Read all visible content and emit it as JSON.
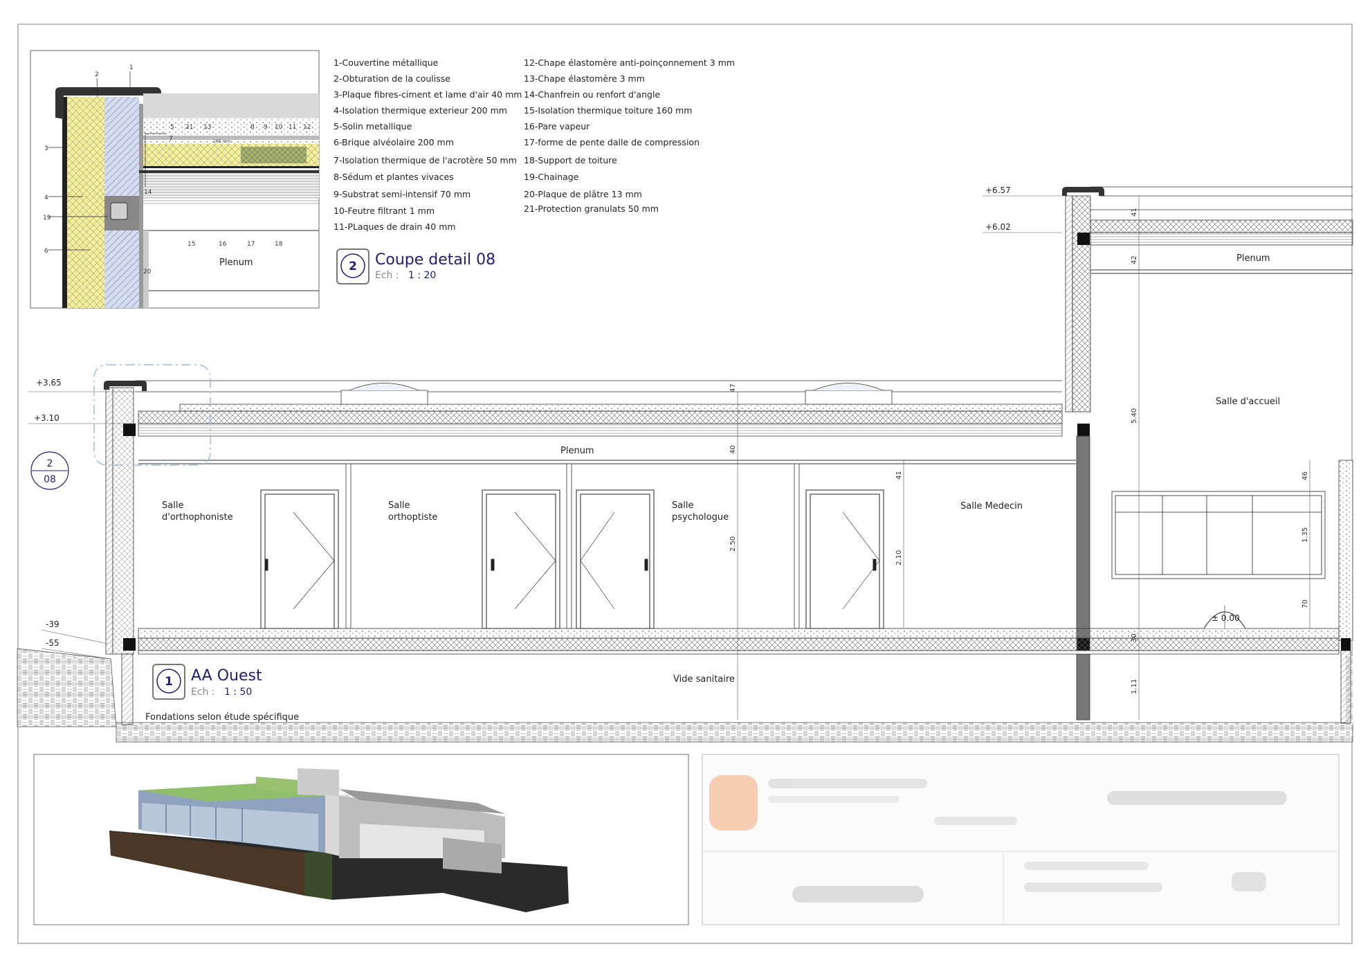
{
  "detail": {
    "callouts": [
      "1",
      "2",
      "3",
      "4",
      "19",
      "6",
      "5",
      "21",
      "13",
      "7",
      "8",
      "9",
      "10",
      "11",
      "12",
      "14",
      "15",
      "16",
      "17",
      "18",
      "20"
    ],
    "dim_small": "160 mm",
    "plenum": "Plenum",
    "bubble_number": "2",
    "title": "Coupe detail 08",
    "scale_prefix": "Ech :",
    "scale_value": "1 : 20"
  },
  "legend": {
    "col1": [
      "1-Couvertine métallique",
      "2-Obturation de la coulisse",
      "3-Plaque fibres-ciment et lame d'air 40 mm",
      "4-Isolation thermique exterieur 200 mm",
      "5-Solin metallique",
      "6-Brique alvéolaire 200 mm",
      "7-Isolation thermique de l'acrotère 50 mm",
      "8-Sédum et plantes vivaces",
      "9-Substrat semi-intensif 70 mm",
      "10-Feutre filtrant 1 mm",
      "11-PLaques de drain 40 mm"
    ],
    "col2": [
      "12-Chape élastomère anti-poinçonnement 3 mm",
      "13-Chape élastomère 3 mm",
      "14-Chanfrein ou renfort d'angle",
      "15-Isolation thermique toiture 160 mm",
      "16-Pare vapeur",
      "17-forme de pente dalle de compression",
      "18-Support de toiture",
      "19-Chainage",
      "20-Plaque de plâtre 13 mm",
      "21-Protection granulats 50 mm"
    ]
  },
  "section": {
    "levels": {
      "l657": "+6.57",
      "l602": "+6.02",
      "l365": "+3.65",
      "l310": "+3.10",
      "m39": "-39",
      "m55": "-55",
      "zero": "± 0.00"
    },
    "detail_ref": {
      "num": "2",
      "sheet": "08"
    },
    "rooms": {
      "plenum_low": "Plenum",
      "plenum_high": "Plenum",
      "ortho1_l1": "Salle",
      "ortho1_l2": "d'orthophoniste",
      "ortho2_l1": "Salle",
      "ortho2_l2": "orthoptiste",
      "psy_l1": "Salle",
      "psy_l2": "psychologue",
      "medecin": "Salle Medecin",
      "accueil": "Salle d'accueil",
      "vide": "Vide sanitaire",
      "fondations": "Fondations selon étude spécifique"
    },
    "dims": {
      "d47": "47",
      "d40": "40",
      "d250": "2.50",
      "d41a": "41",
      "d210": "2.10",
      "d41b": "41",
      "d42": "42",
      "d540": "5.40",
      "d46": "46",
      "d135": "1.35",
      "d70": "70",
      "d30": "30",
      "d111": "1.11"
    },
    "bubble_number": "1",
    "title": "AA Ouest",
    "scale_prefix": "Ech :",
    "scale_value": "1 : 50"
  }
}
